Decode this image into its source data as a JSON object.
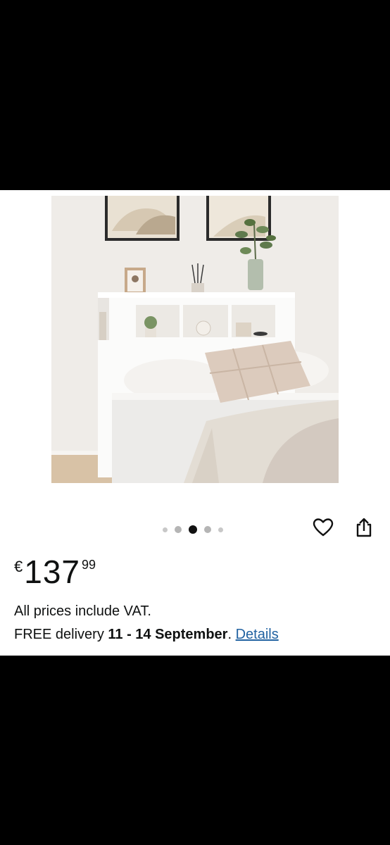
{
  "product": {
    "image_alt": "White bookcase headboard with cream bedding, pillows, framed wall art and plants",
    "carousel": {
      "total": 5,
      "active_index": 2
    }
  },
  "actions": {
    "favourite_icon": "heart-icon",
    "share_icon": "share-icon"
  },
  "price": {
    "currency": "€",
    "whole": "137",
    "fraction": "99"
  },
  "info": {
    "vat_text": "All prices include VAT.",
    "delivery_prefix": "FREE delivery ",
    "delivery_dates": "11 - 14 September",
    "delivery_suffix": ". ",
    "details_link": "Details"
  },
  "colors": {
    "link": "#2162a1",
    "text": "#0f1111",
    "active_dot": "#111111"
  }
}
